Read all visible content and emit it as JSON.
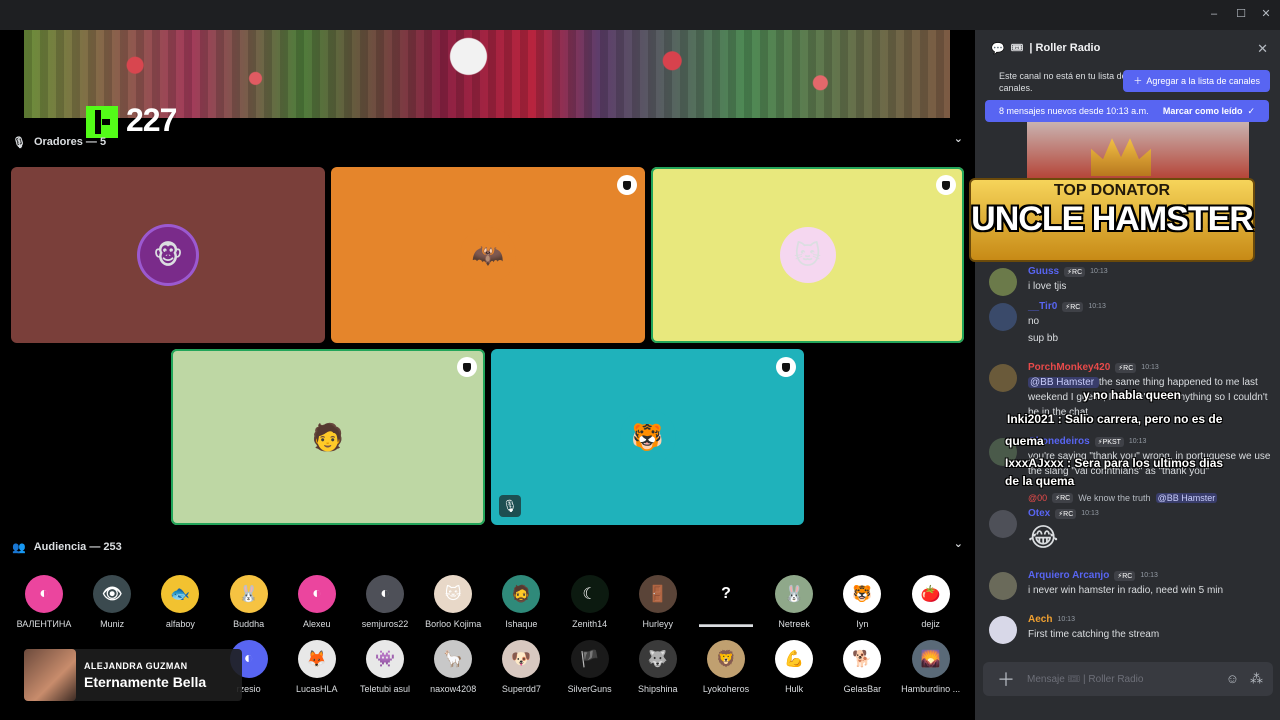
{
  "window": {
    "minimize": "‒",
    "maximize": "☐",
    "close": "✕"
  },
  "stage": {
    "kick_count": "227",
    "speakers_header": "Oradores — 5",
    "audience_header": "Audiencia — 253",
    "speakers": [
      {
        "bg": "#7a3f3a",
        "emoji": "🐵",
        "avatar_bg": "#7a2b8a"
      },
      {
        "bg": "#e5852b",
        "emoji": "🦇",
        "avatar_bg": "#e5852b"
      },
      {
        "bg": "#e8e87d",
        "emoji": "🐱",
        "avatar_bg": "#f5d7f0"
      },
      {
        "bg": "#bed7a4",
        "emoji": "🧑",
        "avatar_bg": "#bed7a4"
      },
      {
        "bg": "#1fb2bb",
        "emoji": "🐯",
        "avatar_bg": "#1fb2bb"
      }
    ],
    "audience": [
      {
        "name": "ВАЛЕНТИНА",
        "color": "#eb459e",
        "glyph": "◐"
      },
      {
        "name": "Muniz",
        "color": "#3b4a4f",
        "glyph": "👁"
      },
      {
        "name": "alfaboy",
        "color": "#f2c230",
        "glyph": "🐟"
      },
      {
        "name": "Buddha",
        "color": "#f6c342",
        "glyph": "🐰"
      },
      {
        "name": "Alexeu",
        "color": "#eb459e",
        "glyph": "◐"
      },
      {
        "name": "semjuros22",
        "color": "#4e5058",
        "glyph": "◐"
      },
      {
        "name": "Borloo Kojima",
        "color": "#e8d8c8",
        "glyph": "🐱"
      },
      {
        "name": "Ishaque",
        "color": "#2f8a7a",
        "glyph": "🧔"
      },
      {
        "name": "Zenith14",
        "color": "#0c1a10",
        "glyph": "☾"
      },
      {
        "name": "Hurleyy",
        "color": "#5a4438",
        "glyph": "🚪"
      },
      {
        "name": "▬▬▬▬▬▬",
        "color": "#000000",
        "glyph": "?"
      },
      {
        "name": "Netreek",
        "color": "#8fa88a",
        "glyph": "🐰"
      },
      {
        "name": "Ιyn",
        "color": "#ffffff",
        "glyph": "🐯"
      },
      {
        "name": "dejiz",
        "color": "#ffffff",
        "glyph": "🍅"
      },
      {
        "name": "",
        "color": "#000000",
        "glyph": ""
      },
      {
        "name": "",
        "color": "#000000",
        "glyph": ""
      },
      {
        "name": "",
        "color": "#000000",
        "glyph": ""
      },
      {
        "name": "rzesio",
        "color": "#5865f2",
        "glyph": "◐"
      },
      {
        "name": "LucasHLA",
        "color": "#e8e8e8",
        "glyph": "🦊"
      },
      {
        "name": "Teletubi asul",
        "color": "#e8e8e8",
        "glyph": "👾"
      },
      {
        "name": "naxow4208",
        "color": "#c8c8c8",
        "glyph": "🦙"
      },
      {
        "name": "Superdd7",
        "color": "#d8c8c0",
        "glyph": "🐶"
      },
      {
        "name": "SilverGuns",
        "color": "#1a1a1a",
        "glyph": "🏴"
      },
      {
        "name": "Shipshina",
        "color": "#3a3a3a",
        "glyph": "🐺"
      },
      {
        "name": "Lyokoheros",
        "color": "#c0a070",
        "glyph": "🦁"
      },
      {
        "name": "Hulk",
        "color": "#ffffff",
        "glyph": "💪"
      },
      {
        "name": "GelasBar",
        "color": "#ffffff",
        "glyph": "🐕"
      },
      {
        "name": "Hamburdino ...",
        "color": "#5a6a78",
        "glyph": "🌄"
      }
    ]
  },
  "now_playing": {
    "artist": "ALEJANDRA GUZMAN",
    "song": "Eternamente Bella"
  },
  "chat": {
    "title": "| Roller Radio",
    "notice": "Este canal no está en tu lista de canales.",
    "add_button": "Agregar a la lista de canales",
    "new_messages": "8 mensajes nuevos desde 10:13 a.m.",
    "mark_read": "Marcar como leído",
    "donor_title": "TOP DONATOR",
    "donor_name": "UNCLE HAMSTER",
    "messages": [
      {
        "user": "Guuss",
        "color": "#5865f2",
        "badge": "RC",
        "time": "10:13",
        "avatar": "#6b7a4a",
        "lines": [
          "i love tjis"
        ]
      },
      {
        "user": "__Tir0",
        "color": "#5865f2",
        "badge": "RC",
        "time": "10:13",
        "avatar": "#3a4a6a",
        "lines": [
          "no",
          "sup bb"
        ]
      },
      {
        "user": "PorchMonkey420",
        "color": "#e84a4a",
        "badge": "RC",
        "time": "10:13",
        "avatar": "#6a5a3a",
        "mention": "@BB Hamster",
        "lines": [
          "the same thing happened to me last weekend I guess, I couldn't hear anything so I couldn't be in the chat"
        ]
      },
      {
        "user": "Gbonedeiros",
        "color": "#5865f2",
        "badge": "PKST",
        "time": "10:13",
        "avatar": "#4a5a4a",
        "lines": [
          "you're saying \"thank you\" wrong, in portuguese we use the slang \"vai corinthians\" as \"thank you\""
        ]
      },
      {
        "user": "Otex",
        "color": "#5865f2",
        "badge": "RC",
        "time": "10:13",
        "avatar": "#4e5058",
        "lines": [
          "😂"
        ]
      },
      {
        "user": "Arquiero Arcanjo",
        "color": "#5865f2",
        "badge": "RC",
        "time": "10:13",
        "avatar": "#6a6a5a",
        "lines": [
          "i never win hamster in radio, need win 5 min"
        ]
      },
      {
        "user": "Aech",
        "color": "#f0a030",
        "badge": "",
        "time": "10:13",
        "avatar": "#d8d8e8",
        "lines": [
          "First time catching the stream"
        ]
      }
    ],
    "reply_preview": {
      "user": "@00",
      "badge": "RC",
      "text": "We know the truth",
      "mention": "@BB Hamster"
    },
    "overlay": [
      {
        "text": "y no habla queen",
        "color": "#ffffff"
      },
      {
        "text": "Inki2021 : Salio carrera, pero no es de",
        "color": "#ffffff"
      },
      {
        "text": "quema",
        "color": "#ffffff"
      },
      {
        "text": "IxxxAJxxx : Sera para los ultimos dias",
        "color": "#ffffff"
      },
      {
        "text": "de la quema",
        "color": "#ffffff"
      }
    ],
    "composer_placeholder": "Mensaje  🎟 | Roller Radio"
  }
}
